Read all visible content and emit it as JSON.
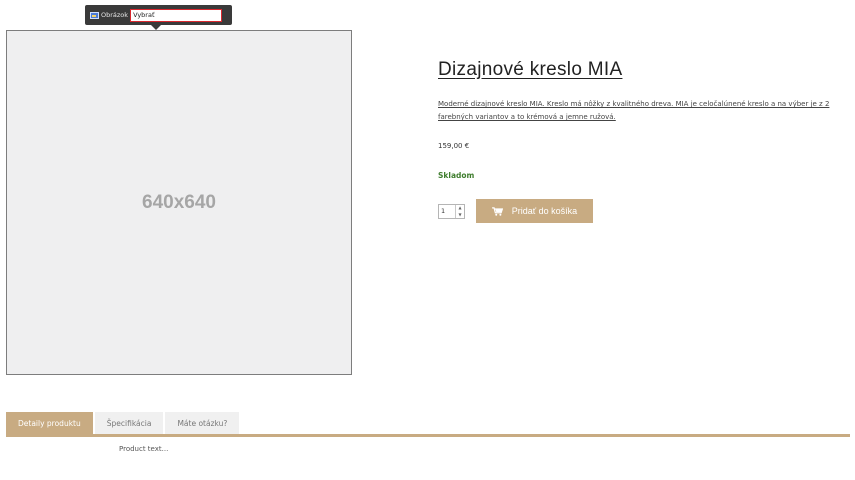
{
  "editor_toolbar": {
    "icon": "image-icon",
    "label": "Obrázok",
    "input_value": "Vybrať"
  },
  "image_placeholder": {
    "text": "640x640"
  },
  "product": {
    "title": "Dizajnové kreslo MIA",
    "description": "Moderné dizajnové kreslo MIA. Kreslo má nôžky z kvalitného dreva. MIA je celočalúnené kreslo a na výber je z 2 farebných variantov a to krémová a jemne ružová.",
    "price": "159,00 €",
    "stock": "Skladom",
    "quantity": "1",
    "add_to_cart_label": "Pridať do košíka",
    "cart_icon": "cart-icon"
  },
  "tabs": [
    {
      "label": "Detaily produktu",
      "active": true
    },
    {
      "label": "Špecifikácia",
      "active": false
    },
    {
      "label": "Máte otázku?",
      "active": false
    }
  ],
  "tab_content": "Product text...",
  "colors": {
    "accent": "#c8ab82",
    "stock_green": "#3f7d2e",
    "toolbar_bg": "#3a3a3a",
    "input_border": "#d9272e"
  }
}
